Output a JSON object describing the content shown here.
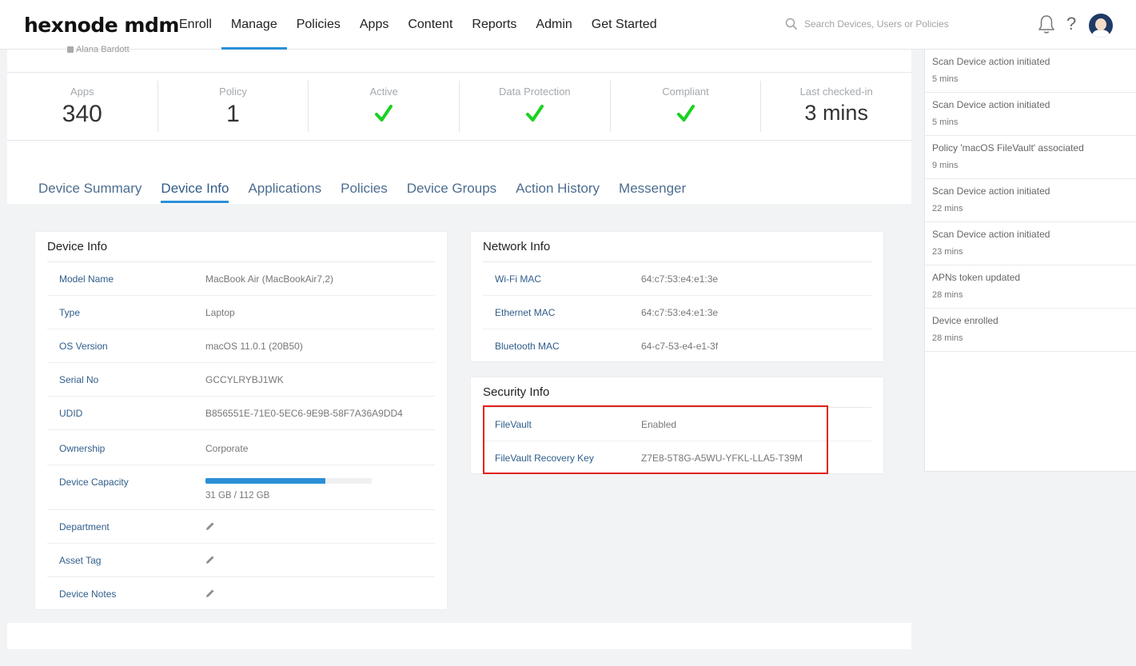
{
  "brand": {
    "logo": "hexnode mdm"
  },
  "nav": {
    "items": [
      {
        "label": "Enroll",
        "active": false
      },
      {
        "label": "Manage",
        "active": true
      },
      {
        "label": "Policies",
        "active": false
      },
      {
        "label": "Apps",
        "active": false
      },
      {
        "label": "Content",
        "active": false
      },
      {
        "label": "Reports",
        "active": false
      },
      {
        "label": "Admin",
        "active": false
      },
      {
        "label": "Get Started",
        "active": false
      }
    ],
    "search_placeholder": "Search Devices, Users or Policies",
    "help_label": "?"
  },
  "device": {
    "owner": "Alana Bardott"
  },
  "stats": [
    {
      "label": "Apps",
      "value": "340",
      "kind": "number"
    },
    {
      "label": "Policy",
      "value": "1",
      "kind": "number"
    },
    {
      "label": "Active",
      "value": "",
      "kind": "check"
    },
    {
      "label": "Data Protection",
      "value": "",
      "kind": "check"
    },
    {
      "label": "Compliant",
      "value": "",
      "kind": "check"
    },
    {
      "label": "Last checked-in",
      "value": "3 mins",
      "kind": "number"
    }
  ],
  "tabs": [
    {
      "label": "Device Summary",
      "active": false
    },
    {
      "label": "Device Info",
      "active": true
    },
    {
      "label": "Applications",
      "active": false
    },
    {
      "label": "Policies",
      "active": false
    },
    {
      "label": "Device Groups",
      "active": false
    },
    {
      "label": "Action History",
      "active": false
    },
    {
      "label": "Messenger",
      "active": false
    }
  ],
  "device_info": {
    "title": "Device Info",
    "rows": [
      {
        "label": "Model Name",
        "value": "MacBook Air (MacBookAir7,2)"
      },
      {
        "label": "Type",
        "value": "Laptop"
      },
      {
        "label": "OS Version",
        "value": "macOS 11.0.1 (20B50)"
      },
      {
        "label": "Serial No",
        "value": "GCCYLRYBJ1WK"
      },
      {
        "label": "UDID",
        "value": "B856551E-71E0-5EC6-9E9B-58F7A36A9DD4"
      },
      {
        "label": "Ownership",
        "value": "Corporate"
      }
    ],
    "capacity": {
      "label": "Device Capacity",
      "text": "31 GB / 112 GB",
      "fill_fraction": 0.72
    },
    "editable_rows": [
      {
        "label": "Department"
      },
      {
        "label": "Asset Tag"
      },
      {
        "label": "Device Notes"
      }
    ]
  },
  "network_info": {
    "title": "Network Info",
    "rows": [
      {
        "label": "Wi-Fi MAC",
        "value": "64:c7:53:e4:e1:3e"
      },
      {
        "label": "Ethernet MAC",
        "value": "64:c7:53:e4:e1:3e"
      },
      {
        "label": "Bluetooth MAC",
        "value": "64-c7-53-e4-e1-3f"
      }
    ]
  },
  "security_info": {
    "title": "Security Info",
    "rows": [
      {
        "label": "FileVault",
        "value": "Enabled"
      },
      {
        "label": "FileVault Recovery Key",
        "value": "Z7E8-5T8G-A5WU-YFKL-LLA5-T39M"
      }
    ]
  },
  "activity": [
    {
      "title": "Scan Device action initiated",
      "time": "5 mins"
    },
    {
      "title": "Scan Device action initiated",
      "time": "5 mins"
    },
    {
      "title": "Policy 'macOS FileVault' associated",
      "time": "9 mins"
    },
    {
      "title": "Scan Device action initiated",
      "time": "22 mins"
    },
    {
      "title": "Scan Device action initiated",
      "time": "23 mins"
    },
    {
      "title": "APNs token updated",
      "time": "28 mins"
    },
    {
      "title": "Device enrolled",
      "time": "28 mins"
    }
  ],
  "colors": {
    "accent": "#2b8fd6",
    "check": "#19d21f",
    "label": "#2f5d8a",
    "highlight": "#e22218"
  }
}
